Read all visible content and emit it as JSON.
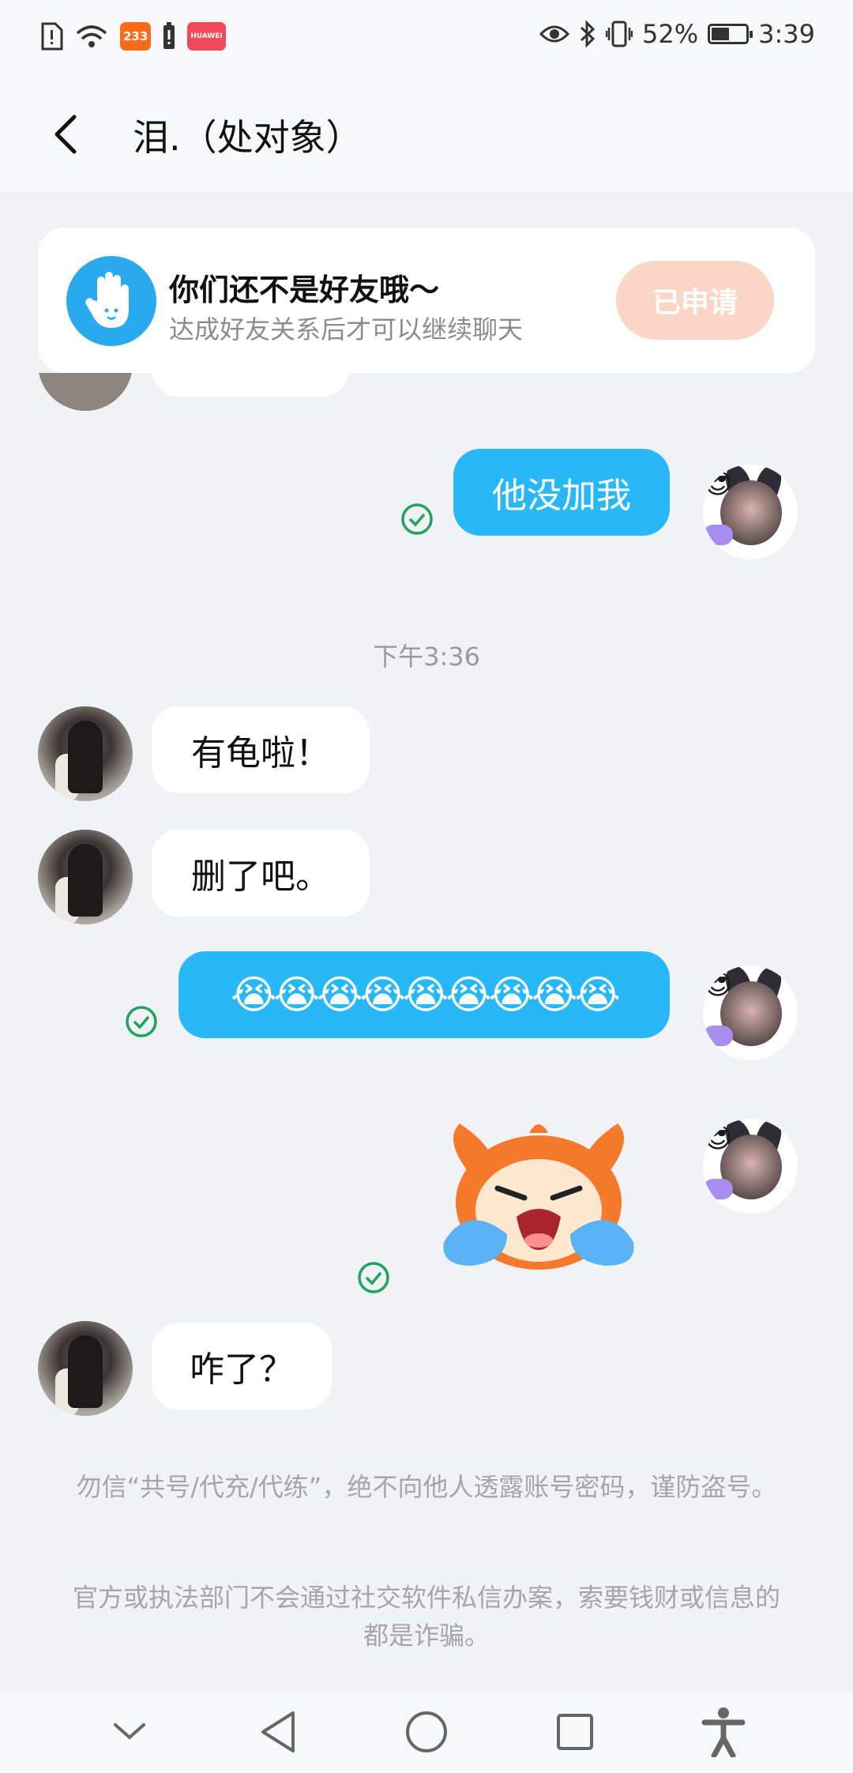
{
  "status_bar": {
    "battery_percent": "52%",
    "battery_level": 0.52,
    "time": "3:39",
    "app_badge_233": "233",
    "app_badge_red": "HUAWEI"
  },
  "header": {
    "title": "泪.（处对象）"
  },
  "friend_banner": {
    "title": "你们还不是好友哦～",
    "subtitle": "达成好友关系后才可以继续聊天",
    "button_label": "已申请"
  },
  "messages": [
    {
      "text": "他没加我"
    },
    {
      "text": "有龟啦！"
    },
    {
      "text": "删了吧。"
    },
    {
      "text": "😭😭😭😭😭😭😭😭😭"
    },
    {
      "text": "咋了？"
    }
  ],
  "time_separator": "下午3:36",
  "notices": [
    "勿信“共号/代充/代练”，绝不向他人透露账号密码，谨防盗号。",
    "官方或执法部门不会通过社交软件私信办案，索要钱财或信息的都是诈骗。"
  ],
  "colors": {
    "outgoing_bubble": "#29b8f7",
    "applied_button": "#fbd5c6",
    "read_mark": "#1fa35f"
  }
}
